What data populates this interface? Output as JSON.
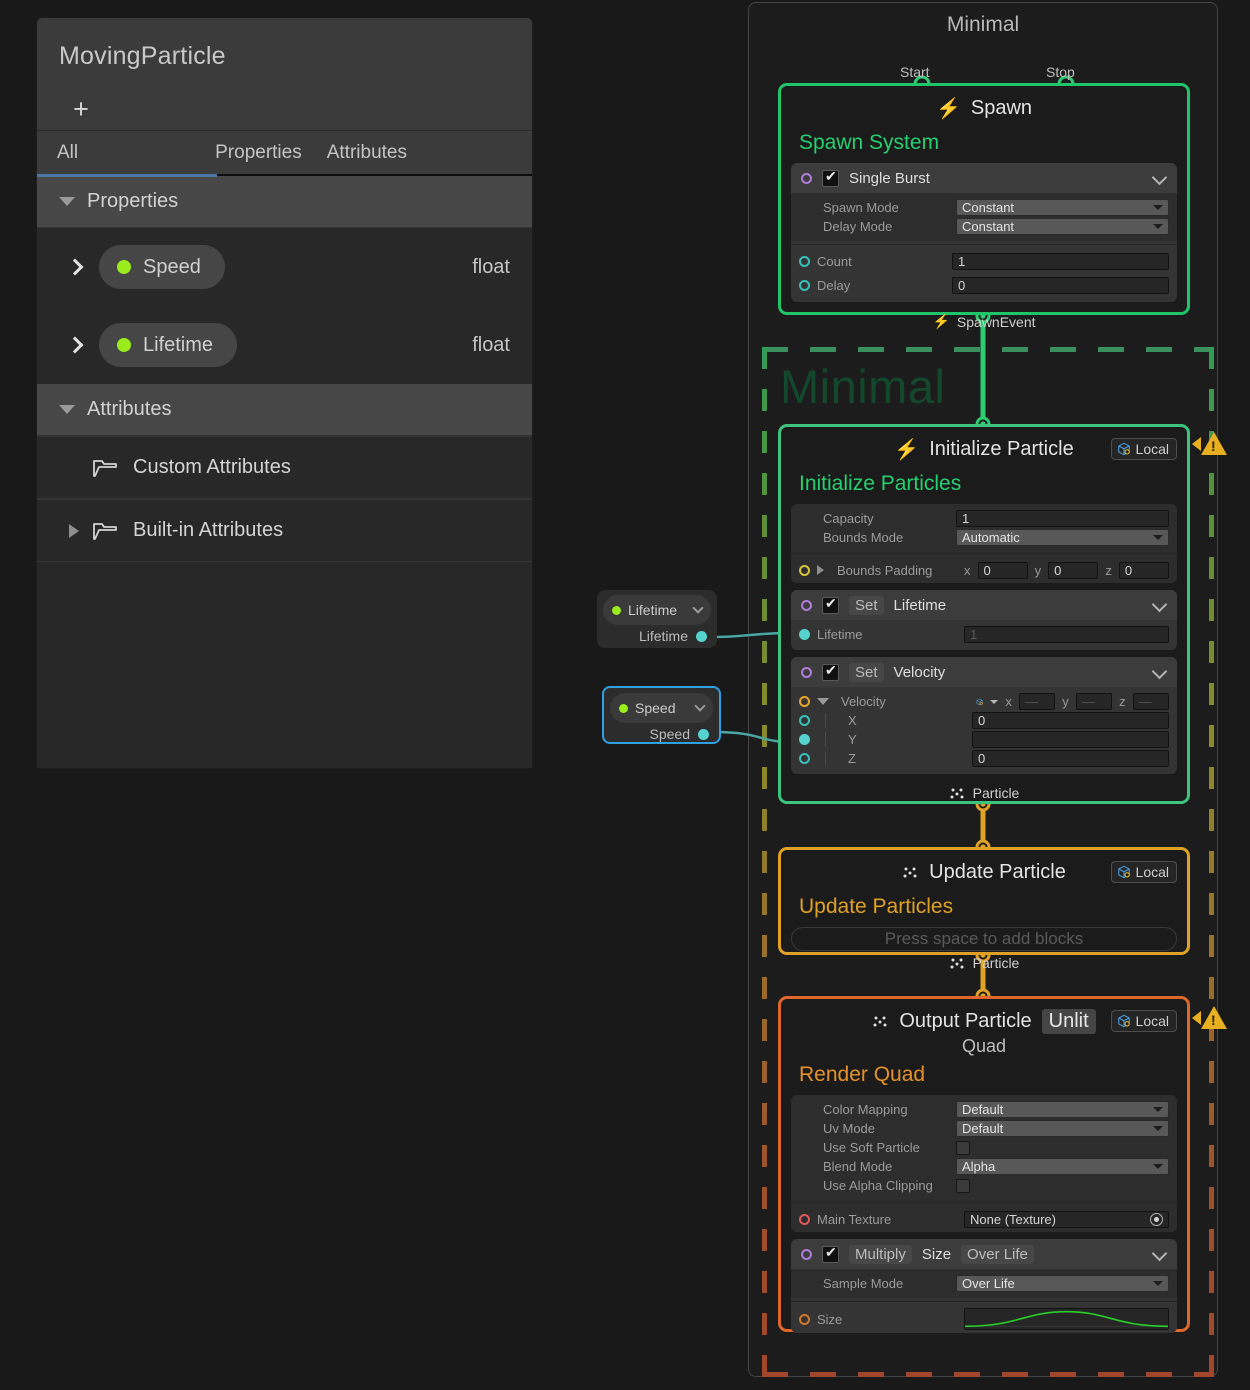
{
  "blackboard": {
    "title": "MovingParticle",
    "add_label": "+",
    "tabs": [
      {
        "label": "All",
        "active": true
      },
      {
        "label": "Properties",
        "active": false
      },
      {
        "label": "Attributes",
        "active": false
      }
    ],
    "sections": [
      {
        "label": "Properties",
        "expanded": true
      },
      {
        "label": "Attributes",
        "expanded": true
      }
    ],
    "properties": [
      {
        "name": "Speed",
        "type": "float",
        "dot_color": "#9bec1c"
      },
      {
        "name": "Lifetime",
        "type": "float",
        "dot_color": "#9bec1c"
      }
    ],
    "attributes": [
      {
        "label": "Custom Attributes",
        "expandable": false
      },
      {
        "label": "Built-in Attributes",
        "expandable": true
      }
    ]
  },
  "graph": {
    "system_frame_title": "Minimal",
    "context_group_label": "Minimal",
    "spawn_node": {
      "title": "Spawn",
      "icon": "bolt-icon",
      "context_title": "Spawn System",
      "input_ports": [
        {
          "label": "Start"
        },
        {
          "label": "Stop"
        }
      ],
      "block": {
        "label": "Single Burst",
        "checked": true,
        "settings": [
          {
            "label": "Spawn Mode",
            "value": "Constant",
            "widget": "dropdown"
          },
          {
            "label": "Delay Mode",
            "value": "Constant",
            "widget": "dropdown"
          }
        ],
        "fields": [
          {
            "label": "Count",
            "value": "1"
          },
          {
            "label": "Delay",
            "value": "0"
          }
        ]
      },
      "output_label": "SpawnEvent"
    },
    "initialize_node": {
      "title": "Initialize Particle",
      "icon": "bolt-icon",
      "space_badge": "Local",
      "context_title": "Initialize Particles",
      "settings": [
        {
          "label": "Capacity",
          "value": "1",
          "widget": "field"
        },
        {
          "label": "Bounds Mode",
          "value": "Automatic",
          "widget": "dropdown"
        }
      ],
      "bounds_padding": {
        "label": "Bounds Padding",
        "x": "0",
        "y": "0",
        "z": "0"
      },
      "blocks": [
        {
          "verb": "Set",
          "name": "Lifetime",
          "checked": true,
          "rows": [
            {
              "label": "Lifetime",
              "value": "1",
              "connected": true
            }
          ]
        },
        {
          "verb": "Set",
          "name": "Velocity",
          "checked": true,
          "vector_label": "Velocity",
          "vector_preview": {
            "x": "",
            "y": "",
            "z": ""
          },
          "rows": [
            {
              "label": "X",
              "value": "0",
              "connected": false
            },
            {
              "label": "Y",
              "value": "",
              "connected": true
            },
            {
              "label": "Z",
              "value": "0",
              "connected": false
            }
          ]
        }
      ],
      "output_label": "Particle",
      "has_warning": true
    },
    "update_node": {
      "title": "Update Particle",
      "space_badge": "Local",
      "context_title": "Update Particles",
      "placeholder": "Press space to add blocks",
      "output_label": "Particle"
    },
    "output_node": {
      "title": "Output Particle",
      "title_chip": "Unlit",
      "subtitle": "Quad",
      "space_badge": "Local",
      "context_title": "Render Quad",
      "settings": [
        {
          "label": "Color Mapping",
          "value": "Default",
          "widget": "dropdown"
        },
        {
          "label": "Uv Mode",
          "value": "Default",
          "widget": "dropdown"
        },
        {
          "label": "Use Soft Particle",
          "value": "",
          "widget": "checkbox"
        },
        {
          "label": "Blend Mode",
          "value": "Alpha",
          "widget": "dropdown"
        },
        {
          "label": "Use Alpha Clipping",
          "value": "",
          "widget": "checkbox"
        }
      ],
      "main_texture": {
        "label": "Main Texture",
        "value": "None (Texture)"
      },
      "block": {
        "verb": "Multiply",
        "name": "Size",
        "qualifier": "Over Life",
        "checked": true,
        "settings": [
          {
            "label": "Sample Mode",
            "value": "Over Life",
            "widget": "dropdown"
          }
        ],
        "curve_row": {
          "label": "Size",
          "curve_color": "#27d227"
        }
      },
      "has_warning": true
    },
    "property_nodes": [
      {
        "name": "Lifetime",
        "output_label": "Lifetime",
        "selected": false
      },
      {
        "name": "Speed",
        "output_label": "Speed",
        "selected": true
      }
    ]
  },
  "colors": {
    "spawn_border": "#20c56a",
    "initialize_border": "#3cc47f",
    "update_border": "#e0a226",
    "output_border": "#e0672c",
    "selection": "#2e9fe0",
    "wire": "#4aa8a4",
    "property_dot": "#9bec1c",
    "warning": "#e8b021"
  }
}
